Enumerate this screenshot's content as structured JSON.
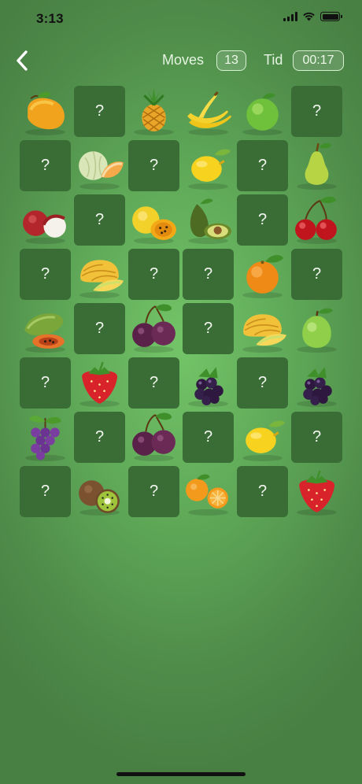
{
  "status": {
    "time": "3:13"
  },
  "header": {
    "moves_label": "Moves",
    "moves_value": "13",
    "time_label": "Tid",
    "time_value": "00:17"
  },
  "colors": {
    "hidden_card": "#3a6c36",
    "background": "#5fa958"
  },
  "board": {
    "hidden_symbol": "?",
    "rows": [
      [
        "mango",
        "hidden",
        "pineapple",
        "banana",
        "lime",
        "hidden"
      ],
      [
        "hidden",
        "melon",
        "hidden",
        "lemon",
        "hidden",
        "pear"
      ],
      [
        "lychee",
        "hidden",
        "passion-fruit",
        "avocado",
        "hidden",
        "cherry"
      ],
      [
        "hidden",
        "galia-melon",
        "hidden",
        "hidden",
        "orange",
        "hidden"
      ],
      [
        "papaya",
        "hidden",
        "plum",
        "hidden",
        "galia-melon",
        "guava"
      ],
      [
        "hidden",
        "strawberry",
        "hidden",
        "blackberry",
        "hidden",
        "blackberry"
      ],
      [
        "grapes",
        "hidden",
        "plum",
        "hidden",
        "lemon",
        "hidden"
      ],
      [
        "hidden",
        "kiwi",
        "hidden",
        "mandarin",
        "hidden",
        "strawberry"
      ]
    ]
  }
}
